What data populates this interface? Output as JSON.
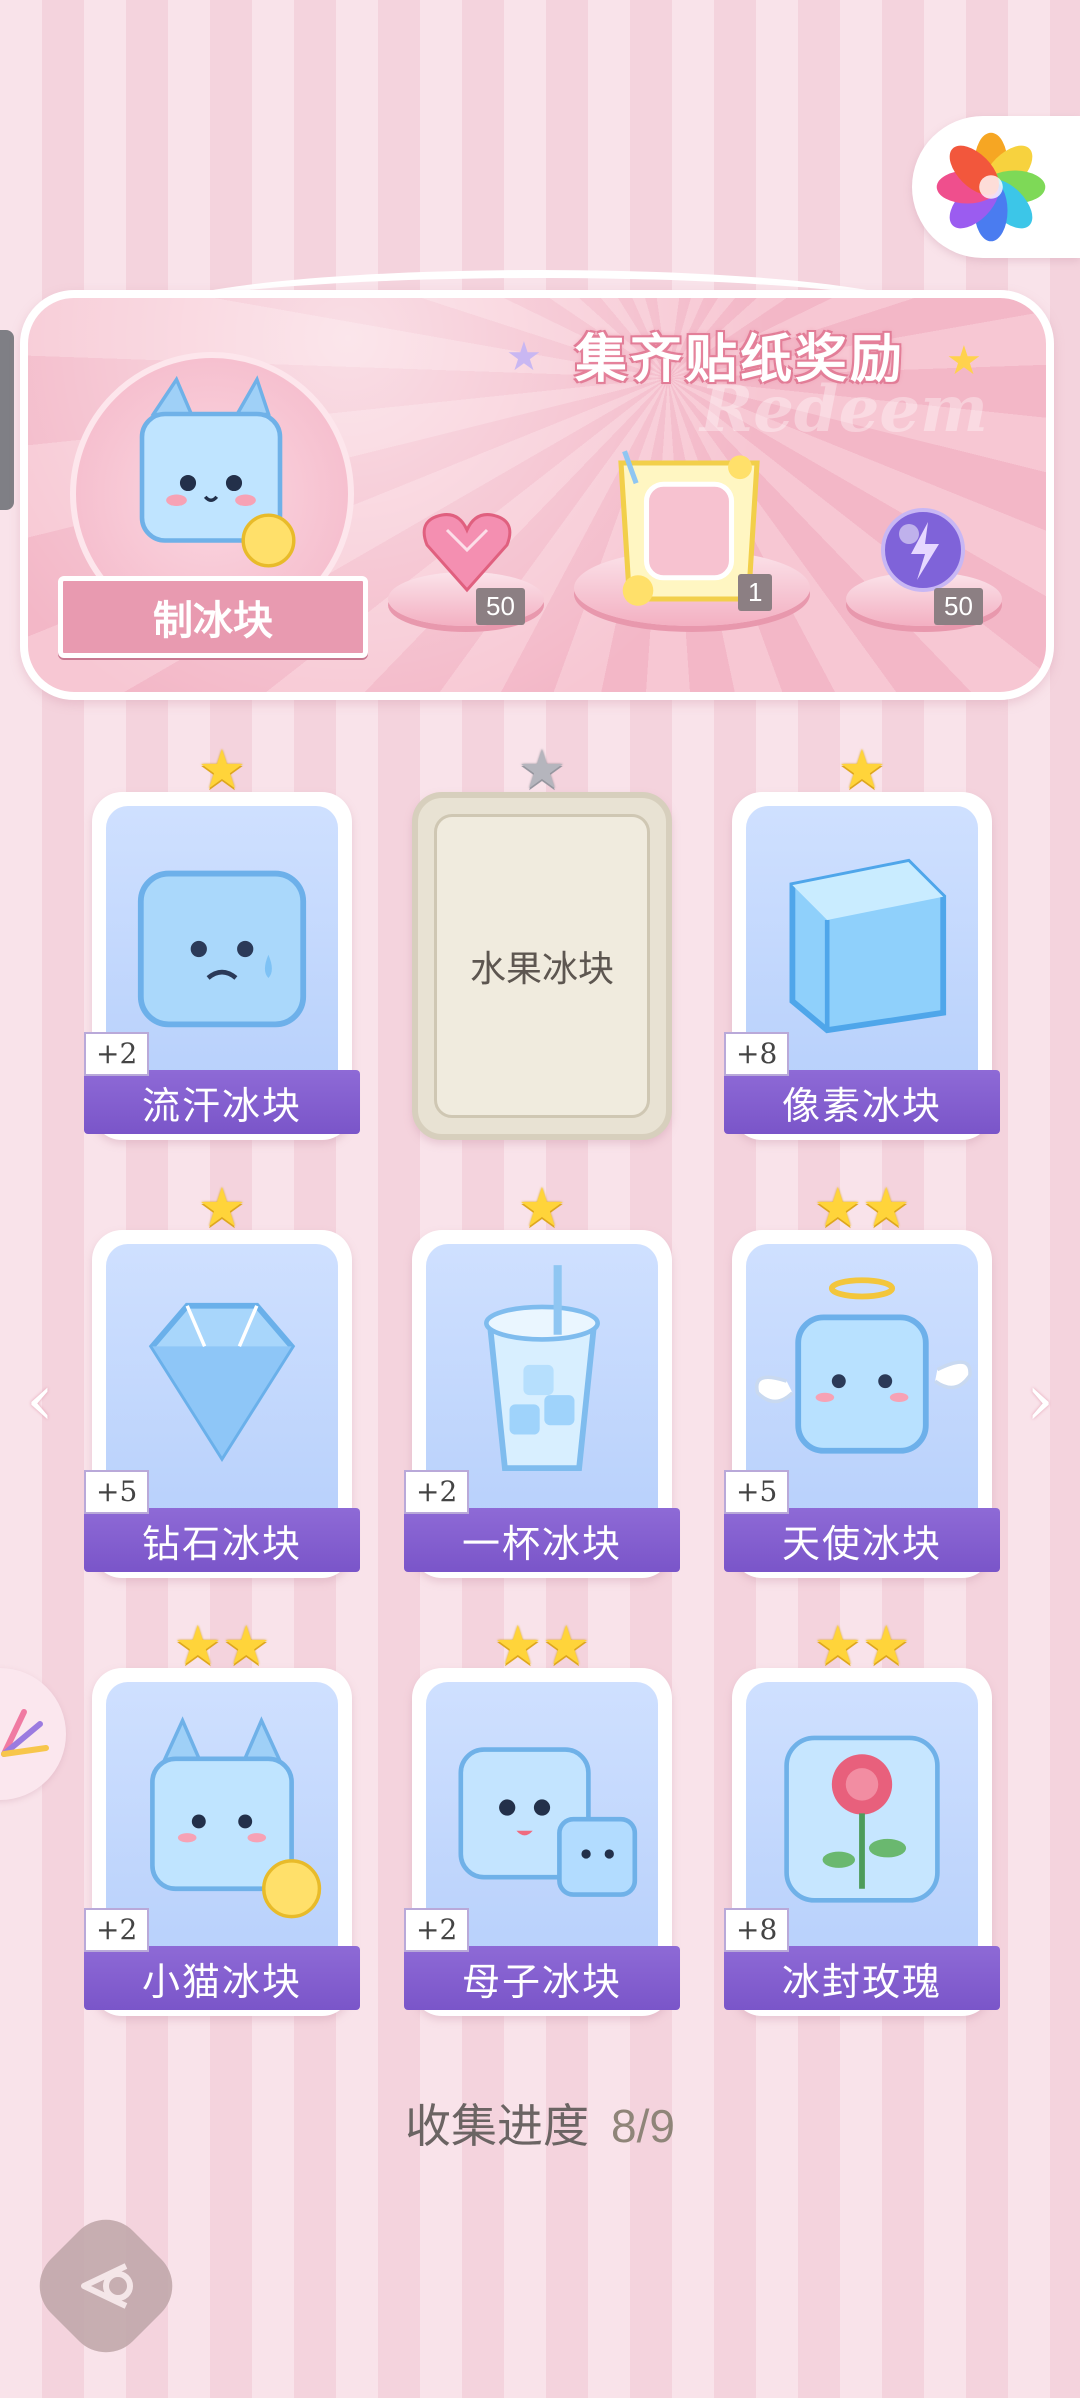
{
  "banner": {
    "title": "集齐贴纸奖励",
    "watermark": "Redeem",
    "make_button": "制冰块",
    "rewards": [
      {
        "icon": "pink-heart-gem-icon",
        "count": "50"
      },
      {
        "icon": "lemonade-photo-frame-icon",
        "count": "1"
      },
      {
        "icon": "lightning-orb-icon",
        "count": "50"
      }
    ]
  },
  "cards": [
    {
      "name": "流汗冰块",
      "bonus": "+2",
      "stars": 1,
      "locked": false,
      "icon": "sweating-ice-cube-icon"
    },
    {
      "name": "水果冰块",
      "bonus": "",
      "stars": 1,
      "locked": true,
      "icon": ""
    },
    {
      "name": "像素冰块",
      "bonus": "+8",
      "stars": 1,
      "locked": false,
      "icon": "pixel-ice-cube-icon"
    },
    {
      "name": "钻石冰块",
      "bonus": "+5",
      "stars": 1,
      "locked": false,
      "icon": "diamond-ice-icon"
    },
    {
      "name": "一杯冰块",
      "bonus": "+2",
      "stars": 1,
      "locked": false,
      "icon": "cup-of-ice-icon"
    },
    {
      "name": "天使冰块",
      "bonus": "+5",
      "stars": 2,
      "locked": false,
      "icon": "angel-ice-cube-icon"
    },
    {
      "name": "小猫冰块",
      "bonus": "+2",
      "stars": 2,
      "locked": false,
      "icon": "cat-ice-cube-icon"
    },
    {
      "name": "母子冰块",
      "bonus": "+2",
      "stars": 2,
      "locked": false,
      "icon": "mother-child-ice-icon"
    },
    {
      "name": "冰封玫瑰",
      "bonus": "+8",
      "stars": 2,
      "locked": false,
      "icon": "frozen-rose-icon"
    }
  ],
  "progress": {
    "label": "收集进度",
    "value": "8/9"
  },
  "colors": {
    "card_label": "#7a55c9",
    "star": "#ffd43a",
    "banner": "#f3b7c7"
  }
}
